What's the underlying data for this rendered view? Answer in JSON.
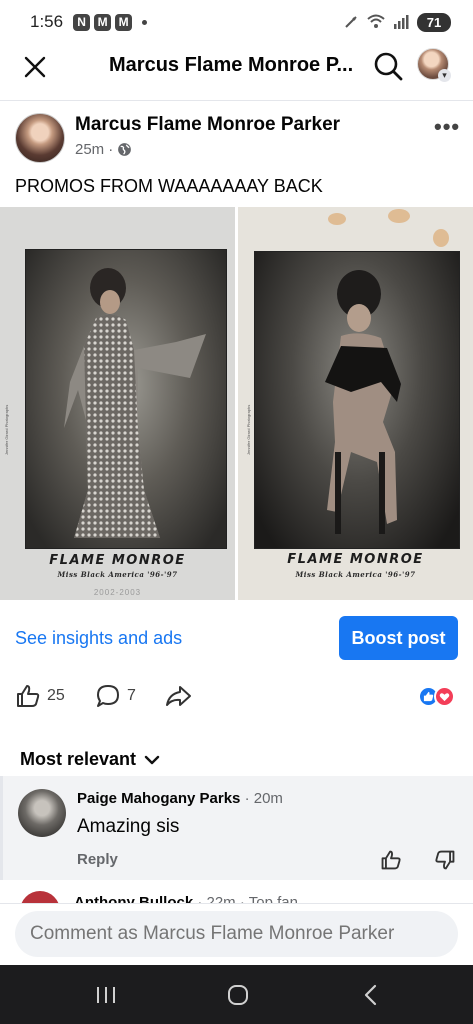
{
  "status_bar": {
    "time": "1:56",
    "notification_icons": [
      "N",
      "M",
      "M"
    ],
    "battery": "71"
  },
  "header": {
    "title": "Marcus Flame Monroe P...",
    "close_icon": "close-icon",
    "search_icon": "search-icon"
  },
  "post": {
    "author": "Marcus Flame Monroe Parker",
    "time": "25m",
    "separator": "·",
    "audience_icon": "globe-icon",
    "text": "PROMOS FROM WAAAAAAAY BACK",
    "photos": [
      {
        "name": "FLAME MONROE",
        "subtitle": "Miss Black America '96-'97",
        "photographer": "Jennifer Girard Photographs",
        "extra": "2002-2003"
      },
      {
        "name": "FLAME MONROE",
        "subtitle": "Miss Black America '96-'97",
        "photographer": "Jennifer Girard Photographs"
      }
    ]
  },
  "insights": {
    "link": "See insights and ads",
    "boost": "Boost post"
  },
  "actions": {
    "likes": "25",
    "comments": "7"
  },
  "comments": {
    "sort_label": "Most relevant",
    "items": [
      {
        "author": "Paige Mahogany Parks",
        "time": "20m",
        "separator": " · ",
        "text": "Amazing sis",
        "reply": "Reply"
      }
    ],
    "next_partial": {
      "author": "Anthony Bullock",
      "meta": " · 22m · Top fan"
    }
  },
  "comment_bar": {
    "placeholder": "Comment as Marcus Flame Monroe Parker"
  },
  "colors": {
    "accent": "#1877f2",
    "love": "#f33e58",
    "secondary_text": "#65676b",
    "nav_bar": "#1c1c1e"
  }
}
